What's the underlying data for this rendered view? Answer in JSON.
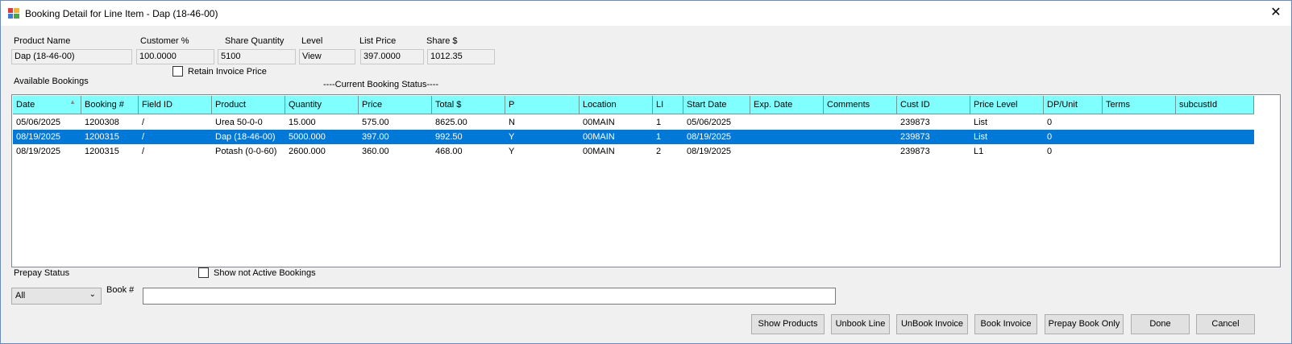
{
  "window": {
    "title": "Booking Detail for Line Item - Dap (18-46-00)",
    "close_glyph": "✕"
  },
  "header_fields": {
    "product_name": {
      "label": "Product Name",
      "value": "Dap (18-46-00)"
    },
    "customer_pct": {
      "label": "Customer %",
      "value": "100.0000"
    },
    "share_quantity": {
      "label": "Share Quantity",
      "value": "5100"
    },
    "level": {
      "label": "Level",
      "value": "View"
    },
    "list_price": {
      "label": "List Price",
      "value": "397.0000"
    },
    "share_dollars": {
      "label": "Share $",
      "value": "1012.35"
    }
  },
  "retain_invoice_price": {
    "label": "Retain Invoice Price",
    "checked": false
  },
  "available_bookings_label": "Available Bookings",
  "current_booking_status": "----Current Booking Status----",
  "grid": {
    "columns": [
      "Date",
      "Booking #",
      "Field ID",
      "Product",
      "Quantity",
      "Price",
      "Total $",
      "P",
      "Location",
      "LI",
      "Start Date",
      "Exp. Date",
      "Comments",
      "Cust ID",
      "Price Level",
      "DP/Unit",
      "Terms",
      "subcustId"
    ],
    "sort_glyph": "▲",
    "rows": [
      [
        "05/06/2025",
        "1200308",
        "/",
        "Urea 50-0-0",
        "15.000",
        "575.00",
        "8625.00",
        "N",
        "00MAIN",
        "1",
        "05/06/2025",
        "",
        "",
        "239873",
        "List",
        "0",
        "",
        ""
      ],
      [
        "08/19/2025",
        "1200315",
        "/",
        "Dap (18-46-00)",
        "5000.000",
        "397.00",
        "992.50",
        "Y",
        "00MAIN",
        "1",
        "08/19/2025",
        "",
        "",
        "239873",
        "List",
        "0",
        "",
        ""
      ],
      [
        "08/19/2025",
        "1200315",
        "/",
        "Potash (0-0-60)",
        "2600.000",
        "360.00",
        "468.00",
        "Y",
        "00MAIN",
        "2",
        "08/19/2025",
        "",
        "",
        "239873",
        "L1",
        "0",
        "",
        ""
      ]
    ],
    "selected_row": 1
  },
  "prepay_status": {
    "label": "Prepay Status",
    "value": "All"
  },
  "show_not_active": {
    "label": "Show not Active Bookings",
    "checked": false
  },
  "book_number": {
    "label": "Book #",
    "value": ""
  },
  "buttons": {
    "show_products": "Show Products",
    "unbook_line": "Unbook Line",
    "unbook_invoice": "UnBook Invoice",
    "book_invoice": "Book Invoice",
    "prepay_book_only": "Prepay Book Only",
    "done": "Done",
    "cancel": "Cancel"
  }
}
